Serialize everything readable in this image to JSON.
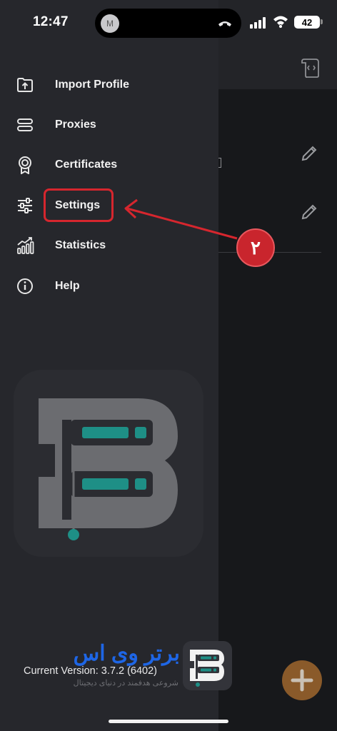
{
  "status_bar": {
    "time": "12:47",
    "island_avatar_initial": "M",
    "battery_level": "42"
  },
  "menu": {
    "items": [
      {
        "label": "Import Profile",
        "icon": "import-profile-icon"
      },
      {
        "label": "Proxies",
        "icon": "proxies-icon"
      },
      {
        "label": "Certificates",
        "icon": "certificate-icon"
      },
      {
        "label": "Settings",
        "icon": "settings-sliders-icon"
      },
      {
        "label": "Statistics",
        "icon": "statistics-icon"
      },
      {
        "label": "Help",
        "icon": "info-icon"
      }
    ]
  },
  "annotation": {
    "step_number": "۲",
    "highlighted_item": "Settings",
    "color": "#d6262e"
  },
  "footer": {
    "version": "Current Version: 3.7.2 (6402)"
  },
  "watermark": {
    "brand": "برتر وی اس",
    "tagline": "شروعی هدفمند در دنیای دیجیتال"
  },
  "colors": {
    "drawer_bg": "#26272c",
    "accent_teal": "#1e8f86",
    "fab": "#8a5a2a",
    "brand_blue": "#1e66e6"
  }
}
